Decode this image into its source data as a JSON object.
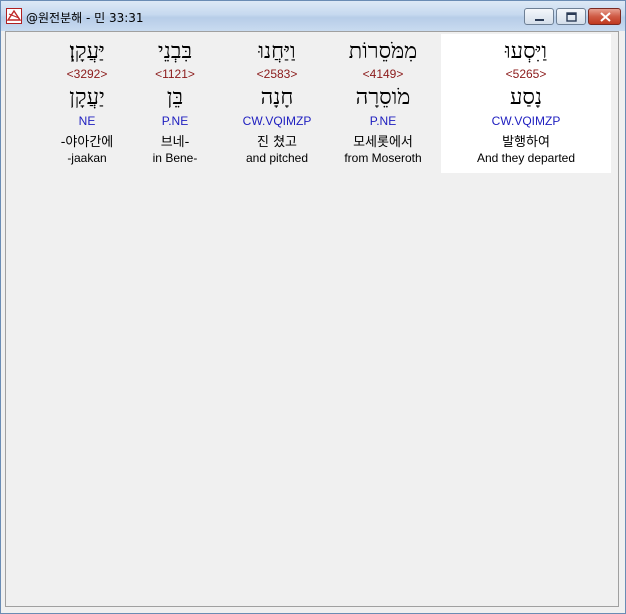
{
  "window": {
    "title": "@원전분해 - 민 33:31"
  },
  "words": [
    {
      "hebrew": "יַּעֲקָֽן׃",
      "number": "<3292>",
      "lemma": "יַעֲקָן",
      "code": "NE",
      "korean": "-야아간에",
      "english": "-jaakan",
      "selected": false
    },
    {
      "hebrew": "בִּבְנֵי",
      "number": "<1121>",
      "lemma": "בֵּן",
      "code": "P.NE",
      "korean": "브네-",
      "english": "in Bene-",
      "selected": false
    },
    {
      "hebrew": "וַיַּחֲנוּ",
      "number": "<2583>",
      "lemma": "חָנָה",
      "code": "CW.VQIMZP",
      "korean": "진 쳤고",
      "english": "and pitched",
      "selected": false
    },
    {
      "hebrew": "מִמֹּסֵרוֹת",
      "number": "<4149>",
      "lemma": "מֹוסֵרָה",
      "code": "P.NE",
      "korean": "모세롯에서",
      "english": "from Moseroth",
      "selected": false
    },
    {
      "hebrew": "וַיִּסְעוּ",
      "number": "<5265>",
      "lemma": "נָסַע",
      "code": "CW.VQIMZP",
      "korean": "발행하여",
      "english": "And they departed",
      "selected": true
    }
  ]
}
